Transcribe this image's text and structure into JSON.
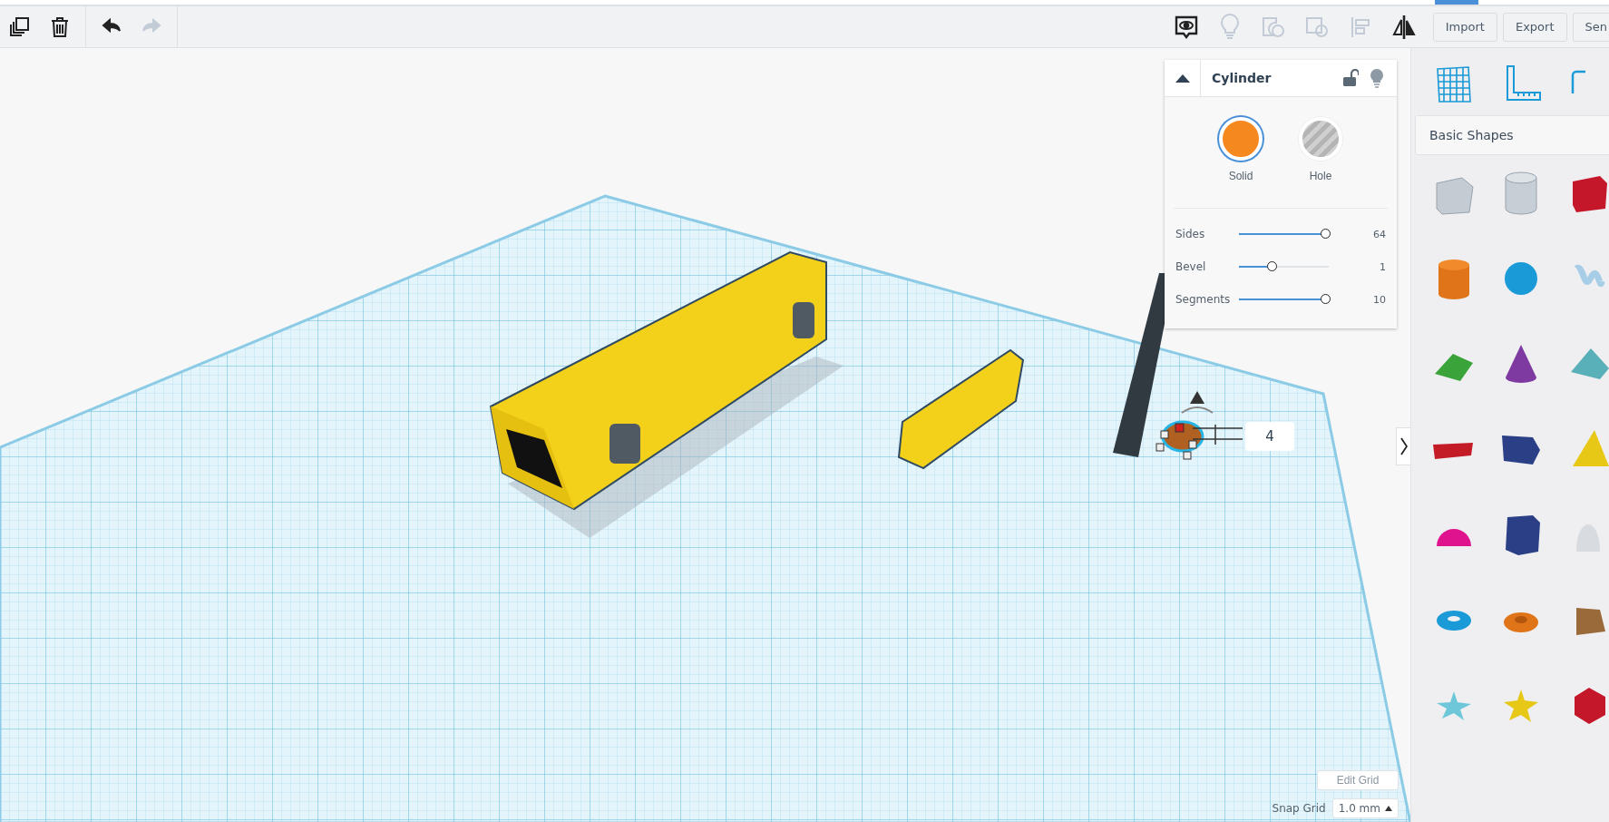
{
  "toolbar": {
    "left_tools": [
      {
        "kind": "duplicate",
        "disabled": false
      },
      {
        "kind": "delete",
        "disabled": false
      },
      {
        "kind": "undo",
        "disabled": false
      },
      {
        "kind": "redo",
        "disabled": true
      }
    ],
    "right_tools": [
      {
        "kind": "notes",
        "disabled": false
      },
      {
        "kind": "light",
        "disabled": true
      },
      {
        "kind": "group",
        "disabled": true
      },
      {
        "kind": "ungroup",
        "disabled": true
      },
      {
        "kind": "align",
        "disabled": true
      },
      {
        "kind": "mirror",
        "disabled": false
      }
    ],
    "buttons": [
      "Import",
      "Export",
      "Sen"
    ]
  },
  "inspector": {
    "title": "Cylinder",
    "locked": false,
    "modes": [
      {
        "label": "Solid",
        "selected": true
      },
      {
        "label": "Hole",
        "selected": false
      }
    ],
    "params": [
      {
        "label": "Sides",
        "level": 0.97,
        "value": "64"
      },
      {
        "label": "Bevel",
        "level": 0.37,
        "value": "1"
      },
      {
        "label": "Segments",
        "level": 0.97,
        "value": "10"
      }
    ]
  },
  "dimension_input": {
    "value": "4"
  },
  "grid_controls": {
    "edit_button": "Edit Grid",
    "snap_label": "Snap Grid",
    "snap_value": "1.0 mm"
  },
  "shapes_panel": {
    "category": "Basic Shapes"
  }
}
